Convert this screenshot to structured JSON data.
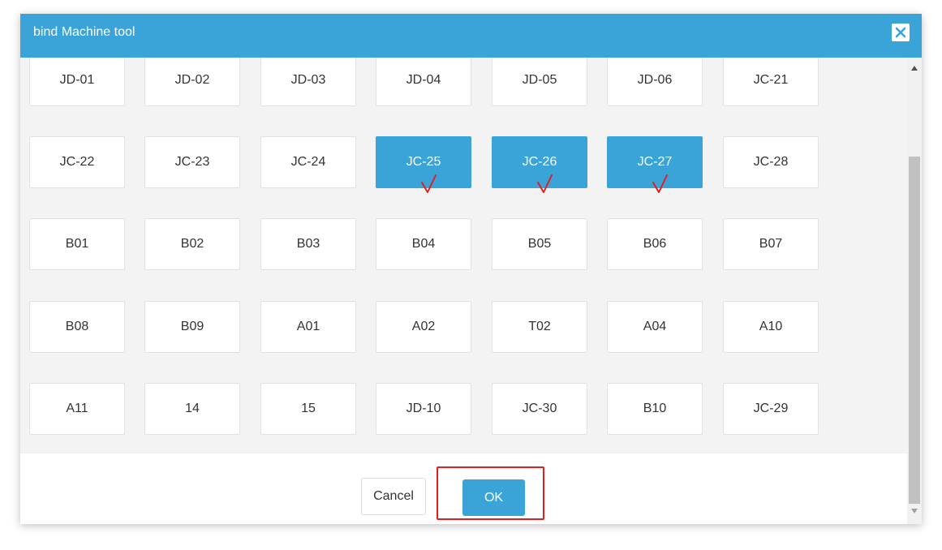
{
  "dialog": {
    "title": "bind Machine tool",
    "close_icon": "close-icon"
  },
  "machines": [
    {
      "label": "JD-01",
      "selected": false
    },
    {
      "label": "JD-02",
      "selected": false
    },
    {
      "label": "JD-03",
      "selected": false
    },
    {
      "label": "JD-04",
      "selected": false
    },
    {
      "label": "JD-05",
      "selected": false
    },
    {
      "label": "JD-06",
      "selected": false
    },
    {
      "label": "JC-21",
      "selected": false
    },
    {
      "label": "JC-22",
      "selected": false
    },
    {
      "label": "JC-23",
      "selected": false
    },
    {
      "label": "JC-24",
      "selected": false
    },
    {
      "label": "JC-25",
      "selected": true
    },
    {
      "label": "JC-26",
      "selected": true
    },
    {
      "label": "JC-27",
      "selected": true
    },
    {
      "label": "JC-28",
      "selected": false
    },
    {
      "label": "B01",
      "selected": false
    },
    {
      "label": "B02",
      "selected": false
    },
    {
      "label": "B03",
      "selected": false
    },
    {
      "label": "B04",
      "selected": false
    },
    {
      "label": "B05",
      "selected": false
    },
    {
      "label": "B06",
      "selected": false
    },
    {
      "label": "B07",
      "selected": false
    },
    {
      "label": "B08",
      "selected": false
    },
    {
      "label": "B09",
      "selected": false
    },
    {
      "label": "A01",
      "selected": false
    },
    {
      "label": "A02",
      "selected": false
    },
    {
      "label": "T02",
      "selected": false
    },
    {
      "label": "A04",
      "selected": false
    },
    {
      "label": "A10",
      "selected": false
    },
    {
      "label": "A11",
      "selected": false
    },
    {
      "label": "14",
      "selected": false
    },
    {
      "label": "15",
      "selected": false
    },
    {
      "label": "JD-10",
      "selected": false
    },
    {
      "label": "JC-30",
      "selected": false
    },
    {
      "label": "B10",
      "selected": false
    },
    {
      "label": "JC-29",
      "selected": false
    }
  ],
  "footer": {
    "cancel_label": "Cancel",
    "ok_label": "OK"
  },
  "colors": {
    "accent": "#3aa4d8",
    "check_mark": "#e02020",
    "highlight_border": "#e02020"
  }
}
